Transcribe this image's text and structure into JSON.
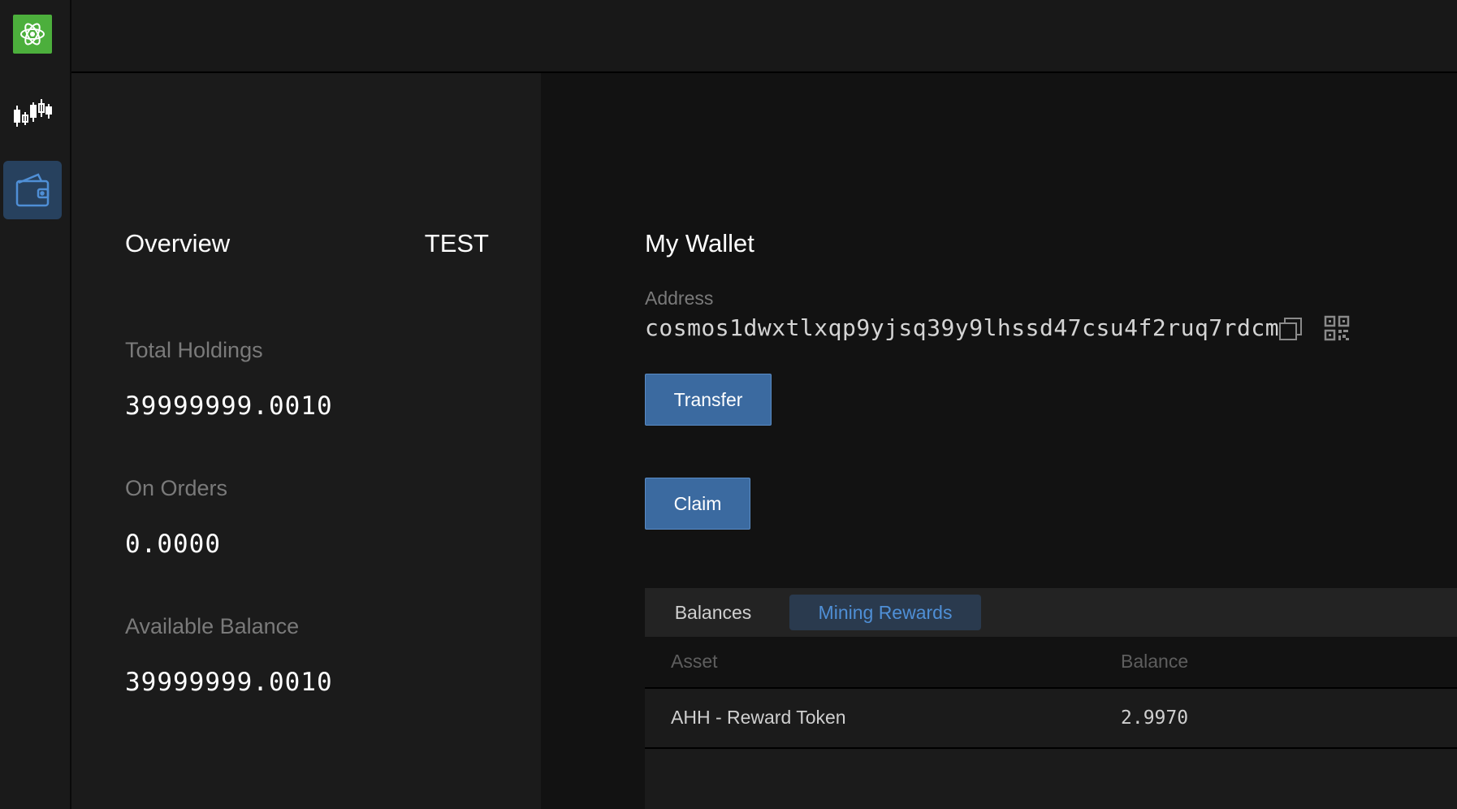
{
  "sidebar": {
    "logo_icon": "atom-logo-icon",
    "items": [
      {
        "icon": "candlestick-chart-icon",
        "active": false
      },
      {
        "icon": "wallet-icon",
        "active": true
      }
    ],
    "colors": {
      "logo_bg": "#4caf3c",
      "active_bg": "#27415e",
      "active_icon": "#4f8fd6"
    }
  },
  "overview": {
    "title": "Overview",
    "network": "TEST",
    "total_holdings_label": "Total Holdings",
    "total_holdings_value": "39999999.0010",
    "on_orders_label": "On Orders",
    "on_orders_value": "0.0000",
    "available_balance_label": "Available Balance",
    "available_balance_value": "39999999.0010"
  },
  "wallet": {
    "title": "My Wallet",
    "address_label": "Address",
    "address_value": "cosmos1dwxtlxqp9yjsq39y9lhssd47csu4f2ruq7rdcm",
    "copy_icon": "copy-icon",
    "qr_icon": "qr-code-icon",
    "transfer_label": "Transfer",
    "claim_label": "Claim",
    "button_color": "#3b6aa0"
  },
  "tabs": {
    "items": [
      {
        "label": "Balances",
        "active": false
      },
      {
        "label": "Mining Rewards",
        "active": true
      }
    ],
    "active_color": "#4f8fd6"
  },
  "table": {
    "columns": [
      "Asset",
      "Balance"
    ],
    "rows": [
      {
        "asset": "AHH - Reward Token",
        "balance": "2.9970"
      }
    ]
  }
}
